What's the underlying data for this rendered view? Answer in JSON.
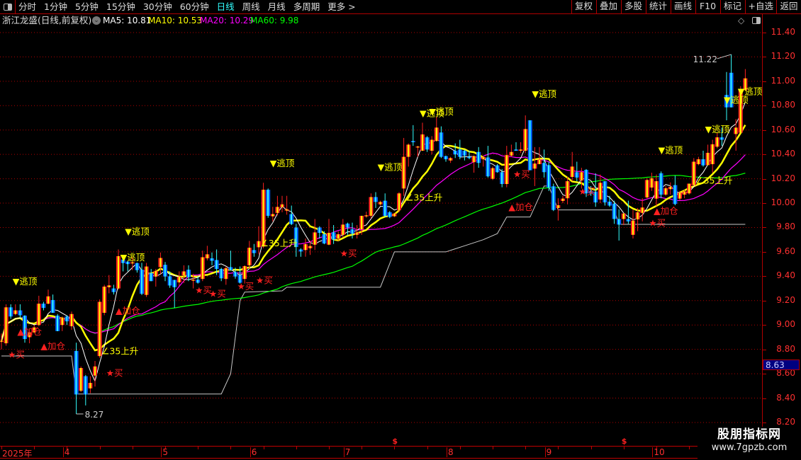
{
  "toolbar": {
    "periods": [
      "分时",
      "1分钟",
      "5分钟",
      "15分钟",
      "30分钟",
      "60分钟",
      "日线",
      "周线",
      "月线",
      "多周期",
      "更多 >"
    ],
    "active_period": "日线",
    "right_buttons": [
      "复权",
      "叠加",
      "多股",
      "统计",
      "画线",
      "F10",
      "标记",
      "+自选",
      "返回"
    ]
  },
  "info": {
    "title": "浙江龙盛(日线,前复权)",
    "ma": [
      {
        "label": "MA5: 10.81",
        "color": "#ffffff"
      },
      {
        "label": "MA10: 10.53",
        "color": "#ffff00"
      },
      {
        "label": "MA20: 10.29",
        "color": "#ff00ff"
      },
      {
        "label": "MA60: 9.98",
        "color": "#00ff00"
      }
    ]
  },
  "colors": {
    "up": "#ff2020",
    "up_inner": "#ffff00",
    "down": "#0060ff",
    "down_inner": "#33ffff",
    "grid": "#b00000",
    "axis_text": "#ff3030"
  },
  "chart_data": {
    "type": "candlestick",
    "y_range": [
      8.2,
      11.4
    ],
    "y_ticks": [
      "11.40",
      "11.20",
      "11.00",
      "10.80",
      "10.60",
      "10.40",
      "10.20",
      "10.00",
      "9.80",
      "9.60",
      "9.40",
      "9.20",
      "9.00",
      "8.80",
      "8.60",
      "8.40",
      "8.20"
    ],
    "grid": true,
    "x_labels": [
      {
        "i": 0,
        "label": "2025年"
      },
      {
        "i": 13,
        "label": "4"
      },
      {
        "i": 34,
        "label": "5"
      },
      {
        "i": 53,
        "label": "6"
      },
      {
        "i": 73,
        "label": "7"
      },
      {
        "i": 95,
        "label": "8"
      },
      {
        "i": 116,
        "label": "9"
      },
      {
        "i": 139,
        "label": "10"
      }
    ],
    "ohlc": [
      [
        8.87,
        8.93,
        8.8,
        8.87
      ],
      [
        8.85,
        9.17,
        8.83,
        9.145
      ],
      [
        9.145,
        9.17,
        9.05,
        9.07
      ],
      [
        9.09,
        9.17,
        9.08,
        9.12
      ],
      [
        9.12,
        9.17,
        9.06,
        9.08
      ],
      [
        9.077,
        9.08,
        8.855,
        8.885
      ],
      [
        8.9,
        8.95,
        8.85,
        8.94
      ],
      [
        8.94,
        9.0,
        8.93,
        8.98
      ],
      [
        9.0,
        9.24,
        8.99,
        9.175
      ],
      [
        9.175,
        9.19,
        9.12,
        9.14
      ],
      [
        9.175,
        9.29,
        9.17,
        9.235
      ],
      [
        9.205,
        9.25,
        9.1,
        9.1
      ],
      [
        9.077,
        9.09,
        8.95,
        8.95
      ],
      [
        9.0,
        9.07,
        8.95,
        9.06
      ],
      [
        9.07,
        9.08,
        9.0,
        9.03
      ],
      [
        8.99,
        9.11,
        8.96,
        9.09
      ],
      [
        8.787,
        8.855,
        8.27,
        8.43
      ],
      [
        8.46,
        8.66,
        8.45,
        8.647
      ],
      [
        8.58,
        8.59,
        8.34,
        8.43
      ],
      [
        8.48,
        8.58,
        8.44,
        8.525
      ],
      [
        8.585,
        8.705,
        8.495,
        8.66
      ],
      [
        8.745,
        9.21,
        8.73,
        9.19
      ],
      [
        9.1,
        9.33,
        9.08,
        9.315
      ],
      [
        9.31,
        9.41,
        9.26,
        9.325
      ],
      [
        9.3,
        9.33,
        9.25,
        9.27
      ],
      [
        9.3,
        9.62,
        9.29,
        9.565
      ],
      [
        9.537,
        9.556,
        9.44,
        9.508
      ],
      [
        9.52,
        9.525,
        9.44,
        9.5
      ],
      [
        9.505,
        9.556,
        9.45,
        9.515
      ],
      [
        9.508,
        9.51,
        9.43,
        9.45
      ],
      [
        9.454,
        9.51,
        9.246,
        9.256
      ],
      [
        9.247,
        9.51,
        9.23,
        9.48
      ],
      [
        9.425,
        9.46,
        9.36,
        9.36
      ],
      [
        9.398,
        9.46,
        9.315,
        9.444
      ],
      [
        9.475,
        9.595,
        9.42,
        9.55
      ],
      [
        9.494,
        9.517,
        9.36,
        9.398
      ],
      [
        9.4,
        9.44,
        9.305,
        9.324
      ],
      [
        9.37,
        9.37,
        9.14,
        9.31
      ],
      [
        9.35,
        9.44,
        9.32,
        9.395
      ],
      [
        9.405,
        9.49,
        9.345,
        9.44
      ],
      [
        9.454,
        9.49,
        9.36,
        9.393
      ],
      [
        9.372,
        9.42,
        9.3,
        9.372
      ],
      [
        9.372,
        9.4,
        9.34,
        9.347
      ],
      [
        9.378,
        9.61,
        9.36,
        9.556
      ],
      [
        9.547,
        9.65,
        9.53,
        9.58
      ],
      [
        9.547,
        9.595,
        9.49,
        9.527
      ],
      [
        9.533,
        9.62,
        9.41,
        9.46
      ],
      [
        9.46,
        9.47,
        9.36,
        9.383
      ],
      [
        9.378,
        9.48,
        9.33,
        9.466
      ],
      [
        9.475,
        9.61,
        9.45,
        9.45
      ],
      [
        9.434,
        9.47,
        9.38,
        9.398
      ],
      [
        9.41,
        9.48,
        9.34,
        9.347
      ],
      [
        9.378,
        9.49,
        9.34,
        9.483
      ],
      [
        9.49,
        9.69,
        9.46,
        9.634
      ],
      [
        9.615,
        9.665,
        9.56,
        9.59
      ],
      [
        9.638,
        9.81,
        9.58,
        9.688
      ],
      [
        9.644,
        10.167,
        9.63,
        10.11
      ],
      [
        10.11,
        10.12,
        9.88,
        9.896
      ],
      [
        9.892,
        9.97,
        9.85,
        9.91
      ],
      [
        9.92,
        10.06,
        9.9,
        9.969
      ],
      [
        9.967,
        10.06,
        9.925,
        9.99
      ],
      [
        9.938,
        10.06,
        9.905,
        9.95
      ],
      [
        9.91,
        9.98,
        9.82,
        9.828
      ],
      [
        9.8,
        9.83,
        9.56,
        9.64
      ],
      [
        9.62,
        9.63,
        9.56,
        9.603
      ],
      [
        9.615,
        9.71,
        9.56,
        9.663
      ],
      [
        9.63,
        9.69,
        9.575,
        9.648
      ],
      [
        9.659,
        9.87,
        9.615,
        9.76
      ],
      [
        9.8,
        9.81,
        9.71,
        9.756
      ],
      [
        9.745,
        9.77,
        9.663,
        9.669
      ],
      [
        9.659,
        9.87,
        9.655,
        9.756
      ],
      [
        9.76,
        9.82,
        9.665,
        9.702
      ],
      [
        9.708,
        9.77,
        9.69,
        9.745
      ],
      [
        9.74,
        9.87,
        9.72,
        9.824
      ],
      [
        9.832,
        9.84,
        9.74,
        9.8
      ],
      [
        9.785,
        9.84,
        9.71,
        9.75
      ],
      [
        9.74,
        9.82,
        9.71,
        9.76
      ],
      [
        9.785,
        9.896,
        9.74,
        9.896
      ],
      [
        9.9,
        9.93,
        9.88,
        9.9
      ],
      [
        9.896,
        10.08,
        9.875,
        10.05
      ],
      [
        10.05,
        10.09,
        9.96,
        10.01
      ],
      [
        9.99,
        10.02,
        9.98,
        10.01
      ],
      [
        10.02,
        10.08,
        9.886,
        9.896
      ],
      [
        9.925,
        9.935,
        9.877,
        9.886
      ],
      [
        9.892,
        9.92,
        9.886,
        9.915
      ],
      [
        9.944,
        10.09,
        9.925,
        10.08
      ],
      [
        10.12,
        10.535,
        10.06,
        10.38
      ],
      [
        10.38,
        10.49,
        10.3,
        10.48
      ],
      [
        10.51,
        10.64,
        10.47,
        10.5
      ],
      [
        10.465,
        10.47,
        10.38,
        10.465
      ],
      [
        10.43,
        10.66,
        10.43,
        10.564
      ],
      [
        10.54,
        10.55,
        10.42,
        10.44
      ],
      [
        10.43,
        10.55,
        10.4,
        10.52
      ],
      [
        10.51,
        10.71,
        10.505,
        10.62
      ],
      [
        10.58,
        10.63,
        10.37,
        10.38
      ],
      [
        10.386,
        10.39,
        10.34,
        10.36
      ],
      [
        10.35,
        10.38,
        10.33,
        10.37
      ],
      [
        10.43,
        10.49,
        10.37,
        10.4
      ],
      [
        10.44,
        10.52,
        10.36,
        10.38
      ],
      [
        10.43,
        10.44,
        10.35,
        10.39
      ],
      [
        10.38,
        10.43,
        10.36,
        10.37
      ],
      [
        10.336,
        10.39,
        10.25,
        10.386
      ],
      [
        10.42,
        10.46,
        10.29,
        10.33
      ],
      [
        10.36,
        10.39,
        10.3,
        10.375
      ],
      [
        10.375,
        10.47,
        10.21,
        10.22
      ],
      [
        10.2,
        10.3,
        10.19,
        10.287
      ],
      [
        10.31,
        10.32,
        10.25,
        10.254
      ],
      [
        10.254,
        10.28,
        10.13,
        10.157
      ],
      [
        10.157,
        10.47,
        10.13,
        10.394
      ],
      [
        10.39,
        10.48,
        10.38,
        10.42
      ],
      [
        10.44,
        10.5,
        10.43,
        10.43
      ],
      [
        10.43,
        10.5,
        10.41,
        10.44
      ],
      [
        10.43,
        10.72,
        10.41,
        10.608
      ],
      [
        10.68,
        10.68,
        10.27,
        10.27
      ],
      [
        10.283,
        10.46,
        10.14,
        10.325
      ],
      [
        10.32,
        10.46,
        10.32,
        10.355
      ],
      [
        10.33,
        10.44,
        10.21,
        10.254
      ],
      [
        10.312,
        10.34,
        10.1,
        10.128
      ],
      [
        10.138,
        10.16,
        9.935,
        9.944
      ],
      [
        9.96,
        10.04,
        9.857,
        9.983
      ],
      [
        10.018,
        10.06,
        10.0,
        10.037
      ],
      [
        10.04,
        10.215,
        9.99,
        10.18
      ],
      [
        10.215,
        10.42,
        10.18,
        10.3
      ],
      [
        10.254,
        10.34,
        10.18,
        10.21
      ],
      [
        10.186,
        10.29,
        10.12,
        10.254
      ],
      [
        10.273,
        10.28,
        10.05,
        10.08
      ],
      [
        10.1,
        10.14,
        10.06,
        10.08
      ],
      [
        10.095,
        10.245,
        9.97,
        10.006
      ],
      [
        10.03,
        10.235,
        10.0,
        10.167
      ],
      [
        10.18,
        10.18,
        9.98,
        10.006
      ],
      [
        10.012,
        10.06,
        9.97,
        9.98
      ],
      [
        9.996,
        10.02,
        9.83,
        9.87
      ],
      [
        9.87,
        9.95,
        9.693,
        9.824
      ],
      [
        9.87,
        9.92,
        9.82,
        9.915
      ],
      [
        9.87,
        10.02,
        9.83,
        9.85
      ],
      [
        9.74,
        9.945,
        9.71,
        9.857
      ],
      [
        9.867,
        9.96,
        9.77,
        9.925
      ],
      [
        9.92,
        10.04,
        9.85,
        9.964
      ],
      [
        10.047,
        10.205,
        10.04,
        10.19
      ],
      [
        10.128,
        10.25,
        10.1,
        10.204
      ],
      [
        10.037,
        10.235,
        9.975,
        10.18
      ],
      [
        10.245,
        10.26,
        10.04,
        10.07
      ],
      [
        10.07,
        10.14,
        10.06,
        10.122
      ],
      [
        10.115,
        10.17,
        10.07,
        10.134
      ],
      [
        10.148,
        10.225,
        9.983,
        9.993
      ],
      [
        10.037,
        10.1,
        10.022,
        10.086
      ],
      [
        10.07,
        10.11,
        10.04,
        10.096
      ],
      [
        10.08,
        10.16,
        10.07,
        10.16
      ],
      [
        10.148,
        10.37,
        10.14,
        10.34
      ],
      [
        10.32,
        10.38,
        10.31,
        10.36
      ],
      [
        10.36,
        10.43,
        10.3,
        10.31
      ],
      [
        10.312,
        10.48,
        10.31,
        10.413
      ],
      [
        10.32,
        10.52,
        10.25,
        10.483
      ],
      [
        10.463,
        10.58,
        10.45,
        10.54
      ],
      [
        10.54,
        10.62,
        10.47,
        10.52
      ],
      [
        10.888,
        11.076,
        10.68,
        10.786
      ],
      [
        11.07,
        11.22,
        10.786,
        10.786
      ],
      [
        10.567,
        10.69,
        10.43,
        10.62
      ],
      [
        10.578,
        10.96,
        10.578,
        10.927
      ],
      [
        10.927,
        11.1,
        10.927,
        11.024
      ]
    ],
    "ma_periods": [
      {
        "n": 5,
        "color": "#ffffff",
        "width": 1
      },
      {
        "n": 10,
        "color": "#ffff00",
        "width": 2.5
      },
      {
        "n": 20,
        "color": "#ff00ff",
        "width": 1.2
      },
      {
        "n": 60,
        "color": "#00ff00",
        "width": 1.2
      }
    ],
    "step_line": {
      "color": "#c8c8c8",
      "knots": [
        [
          0,
          8.746
        ],
        [
          15,
          8.746
        ],
        [
          16,
          8.434
        ],
        [
          47,
          8.434
        ],
        [
          49,
          8.6
        ],
        [
          51,
          9.2
        ],
        [
          52,
          9.27
        ],
        [
          60,
          9.28
        ],
        [
          61,
          9.31
        ],
        [
          81,
          9.31
        ],
        [
          84,
          9.6
        ],
        [
          95,
          9.6
        ],
        [
          99,
          9.65
        ],
        [
          103,
          9.7
        ],
        [
          106,
          9.75
        ],
        [
          108,
          9.886
        ],
        [
          113,
          9.886
        ],
        [
          116,
          10.14
        ],
        [
          117,
          10.14
        ],
        [
          119,
          9.944
        ],
        [
          131,
          9.944
        ],
        [
          132,
          9.826
        ],
        [
          159,
          9.826
        ]
      ]
    },
    "high_label": {
      "i": 156,
      "value": "11.22"
    },
    "low_label": {
      "i": 16,
      "value": "8.27"
    },
    "current_price": "8.63",
    "markers": [
      {
        "i": 3,
        "price": 9.36,
        "kind": "top",
        "label": "▼逃顶"
      },
      {
        "i": 26,
        "price": 9.56,
        "kind": "top",
        "label": "▼逃顶"
      },
      {
        "i": 27,
        "price": 9.77,
        "kind": "top",
        "label": "▼逃顶"
      },
      {
        "i": 58,
        "price": 10.33,
        "kind": "top",
        "label": "▼逃顶"
      },
      {
        "i": 81,
        "price": 10.3,
        "kind": "top",
        "label": "▼逃顶"
      },
      {
        "i": 90,
        "price": 10.74,
        "kind": "top",
        "label": "▼逃顶"
      },
      {
        "i": 92,
        "price": 10.755,
        "kind": "top",
        "label": "▼逃顶"
      },
      {
        "i": 114,
        "price": 10.9,
        "kind": "top",
        "label": "▼逃顶"
      },
      {
        "i": 141,
        "price": 10.44,
        "kind": "top",
        "label": "▼逃顶"
      },
      {
        "i": 151,
        "price": 10.61,
        "kind": "top",
        "label": "▼逃顶"
      },
      {
        "i": 155,
        "price": 10.85,
        "kind": "top",
        "label": "▼逃顶"
      },
      {
        "i": 158,
        "price": 10.92,
        "kind": "top",
        "label": "▼逃顶"
      },
      {
        "i": 2,
        "price": 8.76,
        "kind": "buy",
        "label": "★买"
      },
      {
        "i": 23,
        "price": 8.61,
        "kind": "buy",
        "label": "★买"
      },
      {
        "i": 42,
        "price": 9.29,
        "kind": "buy",
        "label": "★买"
      },
      {
        "i": 45,
        "price": 9.26,
        "kind": "buy",
        "label": "★买"
      },
      {
        "i": 51,
        "price": 9.32,
        "kind": "buy",
        "label": "★买"
      },
      {
        "i": 55,
        "price": 9.37,
        "kind": "buy",
        "label": "★买"
      },
      {
        "i": 73,
        "price": 9.59,
        "kind": "buy",
        "label": "★买"
      },
      {
        "i": 110,
        "price": 10.24,
        "kind": "buy",
        "label": "★买"
      },
      {
        "i": 124,
        "price": 10.1,
        "kind": "buy",
        "label": "★买"
      },
      {
        "i": 139,
        "price": 9.84,
        "kind": "buy",
        "label": "★买"
      },
      {
        "i": 4,
        "price": 8.95,
        "kind": "add",
        "label": "▲加仓"
      },
      {
        "i": 9,
        "price": 8.83,
        "kind": "add",
        "label": "▲加仓"
      },
      {
        "i": 25,
        "price": 9.12,
        "kind": "add",
        "label": "▲加仓"
      },
      {
        "i": 109,
        "price": 9.97,
        "kind": "add",
        "label": "▲加仓"
      },
      {
        "i": 140,
        "price": 9.94,
        "kind": "add",
        "label": "▲加仓"
      },
      {
        "i": 22,
        "price": 8.79,
        "kind": "rise",
        "label": "∠35上升"
      },
      {
        "i": 56,
        "price": 9.675,
        "kind": "rise",
        "label": "∠35上升"
      },
      {
        "i": 87,
        "price": 10.05,
        "kind": "rise",
        "label": "∠35上升"
      },
      {
        "i": 149,
        "price": 10.19,
        "kind": "rise",
        "label": "∠35上升"
      }
    ],
    "dollar_marks": [
      {
        "i": 84,
        "label": "$"
      },
      {
        "i": 133,
        "label": "$"
      }
    ]
  },
  "watermark": {
    "line1": "股朋指标网",
    "line2": "www.7gpzb.com"
  }
}
